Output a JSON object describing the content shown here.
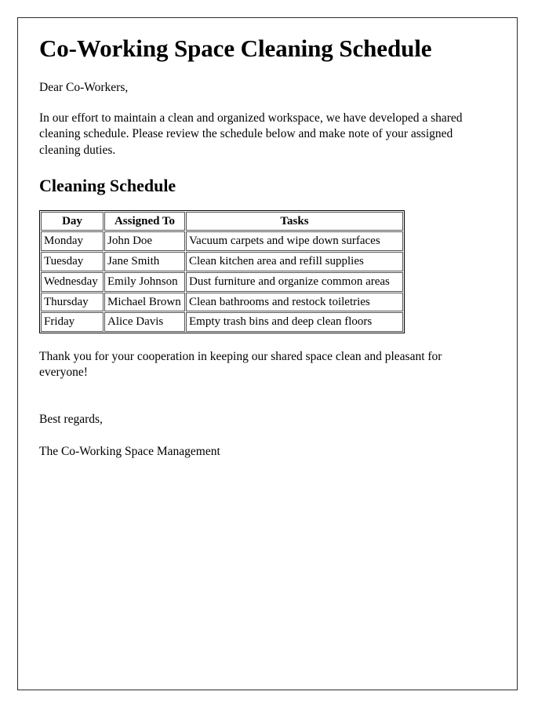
{
  "document": {
    "title": "Co-Working Space Cleaning Schedule",
    "salutation": "Dear Co-Workers,",
    "intro_paragraph": "In our effort to maintain a clean and organized workspace, we have developed a shared cleaning schedule. Please review the schedule below and make note of your assigned cleaning duties.",
    "section_heading": "Cleaning Schedule",
    "closing_paragraph": "Thank you for your cooperation in keeping our shared space clean and pleasant for everyone!",
    "signoff": "Best regards,",
    "signature": "The Co-Working Space Management"
  },
  "table": {
    "headers": [
      "Day",
      "Assigned To",
      "Tasks"
    ],
    "rows": [
      {
        "day": "Monday",
        "assigned_to": "John Doe",
        "tasks": "Vacuum carpets and wipe down surfaces"
      },
      {
        "day": "Tuesday",
        "assigned_to": "Jane Smith",
        "tasks": "Clean kitchen area and refill supplies"
      },
      {
        "day": "Wednesday",
        "assigned_to": "Emily Johnson",
        "tasks": "Dust furniture and organize common areas"
      },
      {
        "day": "Thursday",
        "assigned_to": "Michael Brown",
        "tasks": "Clean bathrooms and restock toiletries"
      },
      {
        "day": "Friday",
        "assigned_to": "Alice Davis",
        "tasks": "Empty trash bins and deep clean floors"
      }
    ]
  },
  "colors": {
    "page_border": "#2b2b2b",
    "text": "#000000",
    "table_border": "#555555"
  }
}
